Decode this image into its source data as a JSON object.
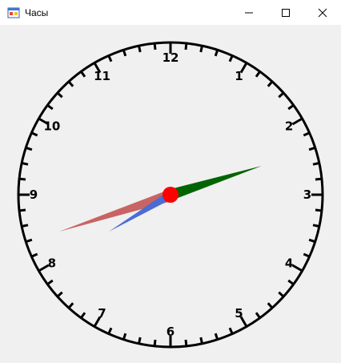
{
  "window": {
    "title": "Часы",
    "icon": "windows-forms-app-icon",
    "controls": [
      "minimize-icon",
      "maximize-icon",
      "close-icon"
    ]
  },
  "clock": {
    "numbers": [
      "12",
      "1",
      "2",
      "3",
      "4",
      "5",
      "6",
      "7",
      "8",
      "9",
      "10",
      "11"
    ],
    "colors": {
      "face_outline": "#000000",
      "hour_hand": "#4a6cd4",
      "minute_hand": "#006400",
      "second_hand": "#c86464",
      "center": "#ff0000"
    }
  }
}
